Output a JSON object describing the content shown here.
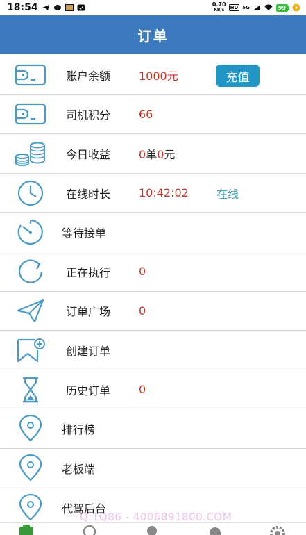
{
  "status_bar": {
    "time": "18:54",
    "net_speed": "0.70",
    "net_speed_unit": "KB/s",
    "hd_badge": "HD",
    "signal_type": "5G",
    "battery": "99"
  },
  "header": {
    "title": "订单"
  },
  "rows": {
    "balance": {
      "label": "账户余额",
      "value": "1000元",
      "button": "充值"
    },
    "points": {
      "label": "司机积分",
      "value": "66"
    },
    "income": {
      "label": "今日收益",
      "orders": "0",
      "orders_unit": "单",
      "amount": "0",
      "amount_unit": "元"
    },
    "online": {
      "label": "在线时长",
      "value": "10:42:02",
      "status": "在线"
    },
    "waiting": {
      "label": "等待接单"
    },
    "executing": {
      "label": "正在执行",
      "value": "0"
    },
    "square": {
      "label": "订单广场",
      "value": "0"
    },
    "create": {
      "label": "创建订单"
    },
    "history": {
      "label": "历史订单",
      "value": "0"
    },
    "ranking": {
      "label": "排行榜"
    },
    "boss": {
      "label": "老板端"
    },
    "backend": {
      "label": "代驾后台"
    }
  },
  "watermark": "Q:1Q86 - 4006891800.COM",
  "colors": {
    "accent": "#3d7bbf",
    "value_red": "#c0392b",
    "button_blue": "#2196c4",
    "icon_blue": "#4a9bc5"
  },
  "icons": {
    "balance": "wallet-icon",
    "points": "wallet-icon",
    "income": "coins-icon",
    "online": "clock-icon",
    "waiting": "timer-icon",
    "executing": "refresh-icon",
    "square": "paper-plane-icon",
    "create": "add-bookmark-icon",
    "history": "hourglass-icon",
    "ranking": "location-pin-icon",
    "boss": "location-pin-icon",
    "backend": "location-pin-icon"
  }
}
